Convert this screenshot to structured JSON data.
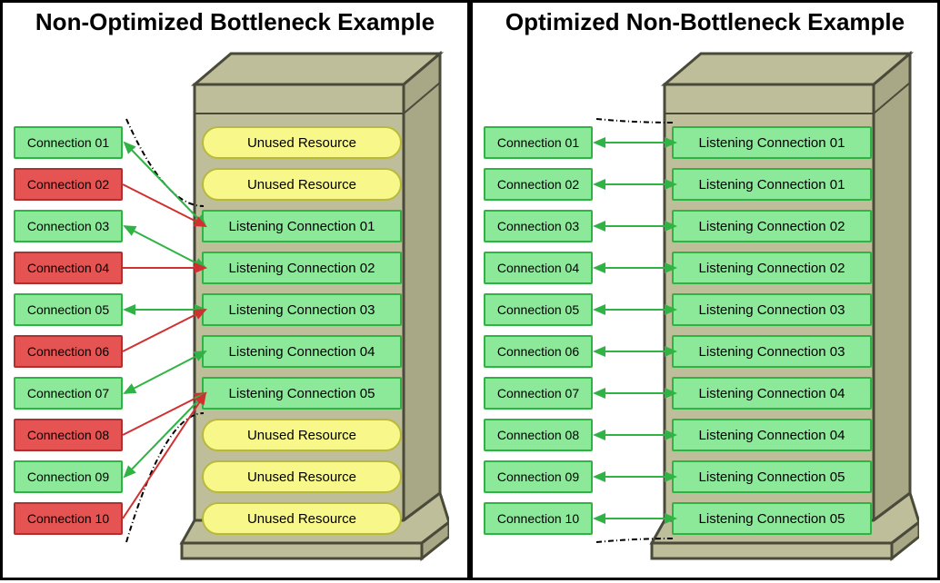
{
  "left": {
    "title": "Non-Optimized Bottleneck Example",
    "resources": [
      {
        "label": "Unused Resource",
        "type": "unused"
      },
      {
        "label": "Unused Resource",
        "type": "unused"
      },
      {
        "label": "Listening Connection 01",
        "type": "listening"
      },
      {
        "label": "Listening Connection 02",
        "type": "listening"
      },
      {
        "label": "Listening Connection 03",
        "type": "listening"
      },
      {
        "label": "Listening Connection 04",
        "type": "listening"
      },
      {
        "label": "Listening Connection 05",
        "type": "listening"
      },
      {
        "label": "Unused Resource",
        "type": "unused"
      },
      {
        "label": "Unused Resource",
        "type": "unused"
      },
      {
        "label": "Unused Resource",
        "type": "unused"
      }
    ],
    "connections": [
      {
        "label": "Connection 01",
        "status": "ok",
        "target": 2
      },
      {
        "label": "Connection 02",
        "status": "fail",
        "target": 2
      },
      {
        "label": "Connection 03",
        "status": "ok",
        "target": 3
      },
      {
        "label": "Connection 04",
        "status": "fail",
        "target": 3
      },
      {
        "label": "Connection 05",
        "status": "ok",
        "target": 4
      },
      {
        "label": "Connection 06",
        "status": "fail",
        "target": 4
      },
      {
        "label": "Connection 07",
        "status": "ok",
        "target": 5
      },
      {
        "label": "Connection 08",
        "status": "fail",
        "target": 6
      },
      {
        "label": "Connection 09",
        "status": "ok",
        "target": 6
      },
      {
        "label": "Connection 10",
        "status": "fail",
        "target": 6
      }
    ]
  },
  "right": {
    "title": "Optimized Non-Bottleneck Example",
    "resources": [
      {
        "label": "Listening Connection 01",
        "type": "listening"
      },
      {
        "label": "Listening Connection 01",
        "type": "listening"
      },
      {
        "label": "Listening Connection 02",
        "type": "listening"
      },
      {
        "label": "Listening Connection 02",
        "type": "listening"
      },
      {
        "label": "Listening Connection 03",
        "type": "listening"
      },
      {
        "label": "Listening Connection 03",
        "type": "listening"
      },
      {
        "label": "Listening Connection 04",
        "type": "listening"
      },
      {
        "label": "Listening Connection 04",
        "type": "listening"
      },
      {
        "label": "Listening Connection 05",
        "type": "listening"
      },
      {
        "label": "Listening Connection 05",
        "type": "listening"
      }
    ],
    "connections": [
      {
        "label": "Connection 01",
        "status": "ok",
        "target": 0
      },
      {
        "label": "Connection 02",
        "status": "ok",
        "target": 1
      },
      {
        "label": "Connection 03",
        "status": "ok",
        "target": 2
      },
      {
        "label": "Connection 04",
        "status": "ok",
        "target": 3
      },
      {
        "label": "Connection 05",
        "status": "ok",
        "target": 4
      },
      {
        "label": "Connection 06",
        "status": "ok",
        "target": 5
      },
      {
        "label": "Connection 07",
        "status": "ok",
        "target": 6
      },
      {
        "label": "Connection 08",
        "status": "ok",
        "target": 7
      },
      {
        "label": "Connection 09",
        "status": "ok",
        "target": 8
      },
      {
        "label": "Connection 10",
        "status": "ok",
        "target": 9
      }
    ]
  },
  "chart_data": {
    "type": "diagram",
    "description": "Comparison of a non-optimized server with bottleneck (5 listening connections, 5 unused resources, 10 client connections of which 5 succeed and 5 fail) versus an optimized server (10 listening connections, all 10 client connections succeed).",
    "left_panel": {
      "listening_connections": 5,
      "unused_resources": 5,
      "client_connections_total": 10,
      "client_connections_success": 5,
      "client_connections_fail": 5
    },
    "right_panel": {
      "listening_connections": 10,
      "unused_resources": 0,
      "client_connections_total": 10,
      "client_connections_success": 10,
      "client_connections_fail": 0
    }
  }
}
